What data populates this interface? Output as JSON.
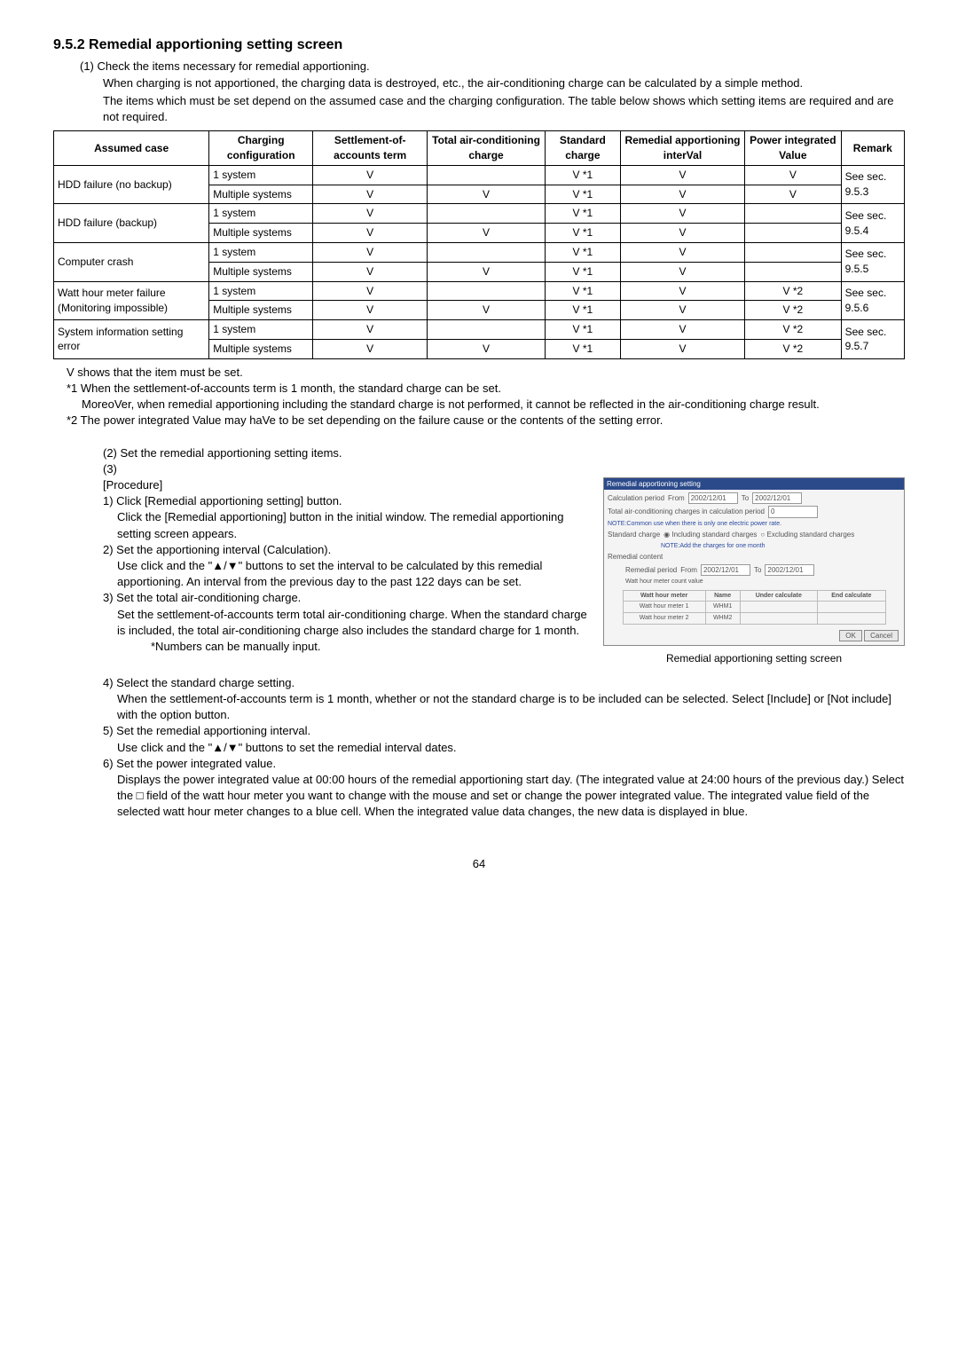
{
  "heading": "9.5.2 Remedial apportioning setting screen",
  "intro_item": "(1)  Check the items necessary for remedial apportioning.",
  "intro_para1": "When charging is not apportioned, the charging data is destroyed, etc., the air-conditioning charge can be calculated by a simple method.",
  "intro_para2": "The items which must be set depend on the assumed case and the charging configuration. The table below shows which setting items are required and are not required.",
  "table": {
    "headers": {
      "c1": "Assumed case",
      "c2": "Charging configuration",
      "c3": "Settlement-of-accounts term",
      "c4": "Total air-conditioning charge",
      "c5": "Standard charge",
      "c6": "Remedial apportioning interVal",
      "c7": "Power integrated Value",
      "c8": "Remark"
    },
    "rows": [
      {
        "case": "HDD failure (no backup)",
        "cfg": "1 system",
        "c3": "V",
        "c4": "",
        "c5": "V *1",
        "c6": "V",
        "c7": "V",
        "remark": "See sec. 9.5.3",
        "rowspan": 2
      },
      {
        "case": "",
        "cfg": "Multiple systems",
        "c3": "V",
        "c4": "V",
        "c5": "V *1",
        "c6": "V",
        "c7": "V",
        "remark": ""
      },
      {
        "case": "HDD failure (backup)",
        "cfg": "1 system",
        "c3": "V",
        "c4": "",
        "c5": "V *1",
        "c6": "V",
        "c7": "",
        "remark": "See sec. 9.5.4",
        "rowspan": 2
      },
      {
        "case": "",
        "cfg": "Multiple systems",
        "c3": "V",
        "c4": "V",
        "c5": "V *1",
        "c6": "V",
        "c7": "",
        "remark": ""
      },
      {
        "case": "Computer crash",
        "cfg": "1 system",
        "c3": "V",
        "c4": "",
        "c5": "V *1",
        "c6": "V",
        "c7": "",
        "remark": "See sec. 9.5.5",
        "rowspan": 2
      },
      {
        "case": "",
        "cfg": "Multiple systems",
        "c3": "V",
        "c4": "V",
        "c5": "V *1",
        "c6": "V",
        "c7": "",
        "remark": ""
      },
      {
        "case": "Watt hour meter failure (Monitoring impossible)",
        "cfg": "1 system",
        "c3": "V",
        "c4": "",
        "c5": "V *1",
        "c6": "V",
        "c7": "V *2",
        "remark": "See sec. 9.5.6",
        "rowspan": 2
      },
      {
        "case": "",
        "cfg": "Multiple systems",
        "c3": "V",
        "c4": "V",
        "c5": "V *1",
        "c6": "V",
        "c7": "V *2",
        "remark": ""
      },
      {
        "case": "System information setting error",
        "cfg": "1 system",
        "c3": "V",
        "c4": "",
        "c5": "V *1",
        "c6": "V",
        "c7": "V *2",
        "remark": "See sec. 9.5.7",
        "rowspan": 2
      },
      {
        "case": "",
        "cfg": "Multiple systems",
        "c3": "V",
        "c4": "V",
        "c5": "V *1",
        "c6": "V",
        "c7": "V *2",
        "remark": ""
      }
    ]
  },
  "notes": {
    "n0": "V shows that the item must be set.",
    "n1a": "*1 When the settlement-of-accounts term is 1 month, the standard charge can be set.",
    "n1b": "MoreoVer, when remedial apportioning including the standard charge is not performed, it cannot be reflected in the air-conditioning charge result.",
    "n2": "*2 The power integrated Value may haVe to be set depending on the failure cause or the contents of the setting error."
  },
  "step2": "(2)  Set the remedial apportioning setting items.",
  "step3": "(3)",
  "procedure_label": "[Procedure]",
  "proc": {
    "s1h": "1) Click [Remedial apportioning setting] button.",
    "s1b": "Click the [Remedial apportioning] button in the initial window. The remedial apportioning setting screen appears.",
    "s2h": "2) Set the apportioning interval (Calculation).",
    "s2b": "Use click and the \"▲/▼\" buttons to set the interval to be calculated by this remedial apportioning. An interval from the previous day to the past 122 days can be set.",
    "s3h": "3) Set the total air-conditioning charge.",
    "s3b": "Set the settlement-of-accounts term total air-conditioning charge. When the standard charge is included, the total air-conditioning charge also includes the standard charge for 1 month.",
    "s3note": "*Numbers can be manually input.",
    "s4h": "4) Select the standard charge setting.",
    "s4b": "When the settlement-of-accounts term is 1 month, whether or not the standard charge is to be included can be selected. Select [Include] or [Not include] with the option button.",
    "s5h": "5) Set the remedial apportioning interval.",
    "s5b": "Use click and the \"▲/▼\" buttons to set the remedial interval dates.",
    "s6h": "6) Set the power integrated value.",
    "s6b": "Displays the power integrated value at 00:00 hours of the remedial apportioning start day. (The integrated value at 24:00 hours of the previous day.) Select the □ field of the watt hour meter you want to change with the mouse and set or change the power integrated value. The integrated value field of the selected watt hour meter changes to a blue cell. When the integrated value data changes, the new data is displayed in blue."
  },
  "screenshot": {
    "title": "Remedial apportioning setting",
    "calc_label": "Calculation period",
    "from": "From",
    "to": "To",
    "date1": "2002/12/01",
    "date2": "2002/12/01",
    "total_label": "Total air-conditioning charges in calculation period",
    "note_small": "NOTE:Common use when there is only one electric power rate.",
    "std_label": "Standard charge",
    "opt1": "Including standard charges",
    "opt2": "Excluding standard charges",
    "std_note": "NOTE:Add the charges for one month",
    "rem_label": "Remedial content",
    "rem_period": "Remedial period",
    "date3": "2002/12/01",
    "date4": "2002/12/01",
    "whm_label": "Watt hour meter count value",
    "th1": "Watt hour meter",
    "th2": "Name",
    "th3": "Under calculate",
    "th4": "End calculate",
    "r1a": "Watt hour meter 1",
    "r1b": "WHM1",
    "r2a": "Watt hour meter 2",
    "r2b": "WHM2",
    "ok": "OK",
    "cancel": "Cancel",
    "caption": "Remedial apportioning setting screen"
  },
  "page": "64"
}
